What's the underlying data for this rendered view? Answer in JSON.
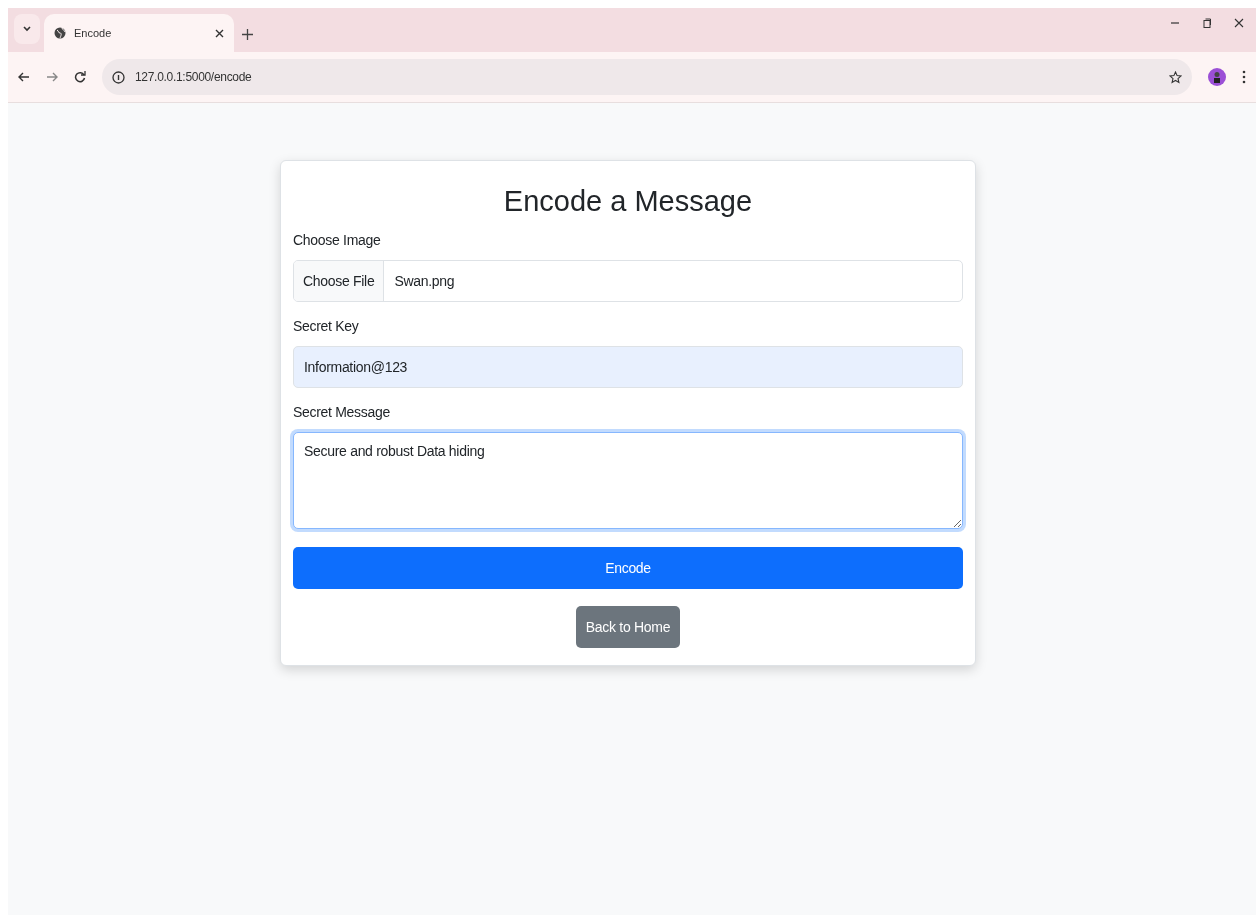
{
  "browser": {
    "tabs": [
      {
        "title": "Encode",
        "selected": true
      }
    ],
    "url": "127.0.0.1:5000/encode"
  },
  "form": {
    "title": "Encode a Message",
    "fields": [
      {
        "kind": "file",
        "label": "Choose Image",
        "button": "Choose File",
        "value": "Swan.png",
        "focused": false,
        "autofilled": false
      },
      {
        "kind": "text",
        "label": "Secret Key",
        "value": "Information@123",
        "focused": false,
        "autofilled": true
      },
      {
        "kind": "textarea",
        "label": "Secret Message",
        "value": "Secure and robust Data hiding",
        "focused": true,
        "autofilled": false
      }
    ],
    "buttons": [
      {
        "kind": "primary",
        "label": "Encode"
      },
      {
        "kind": "secondary",
        "label": "Back to Home"
      }
    ]
  }
}
